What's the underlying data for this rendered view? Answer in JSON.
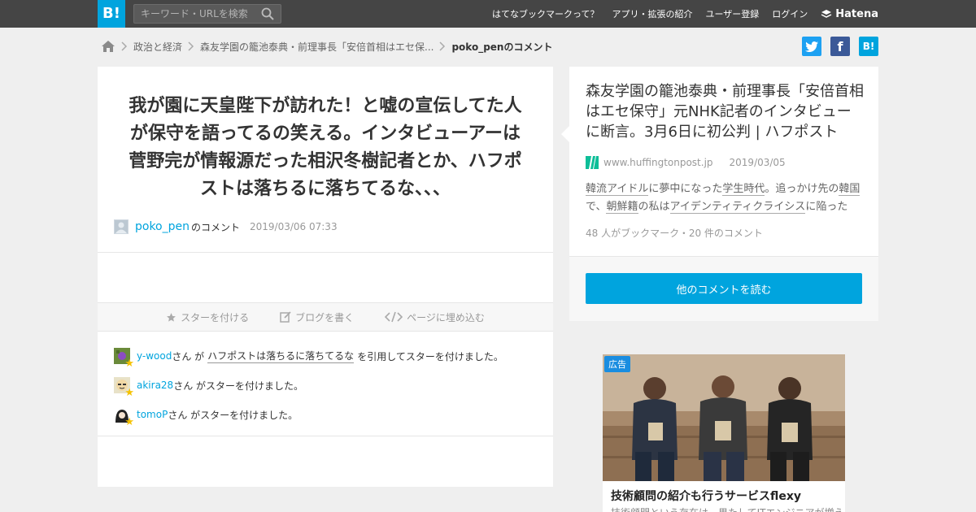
{
  "header": {
    "logo": "B!",
    "search_placeholder": "キーワード・URLを検索",
    "nav": [
      "はてなブックマークって？",
      "アプリ・拡張の紹介",
      "ユーザー登録",
      "ログイン"
    ],
    "brand": "Hatena"
  },
  "breadcrumb": {
    "items": [
      "政治と経済",
      "森友学園の籠池泰典・前理事長「安倍首相はエセ保...",
      "poko_penのコメント"
    ]
  },
  "share": {
    "facebook": "f",
    "hatena": "B!"
  },
  "comment": {
    "text": "我が園に天皇陛下が訪れた！と嘘の宣伝してた人が保守を語ってるの笑える。インタビューアーは菅野完が情報源だった相沢冬樹記者とか、ハフポストは落ちるに落ちてるな、、、",
    "user": "poko_pen",
    "user_suffix": "のコメント",
    "date": "2019/03/06 07:33"
  },
  "actions": {
    "star": "スターを付ける",
    "blog": "ブログを書く",
    "embed": "ページに埋め込む"
  },
  "stars": [
    {
      "user": "y-wood",
      "pre": "さん が",
      "quote": "ハフポストは落ちるに落ちてるな",
      "post": "を引用してスターを付けました。"
    },
    {
      "user": "akira28",
      "pre": "さん がスターを付けました。",
      "quote": "",
      "post": ""
    },
    {
      "user": "tomoP",
      "pre": "さん がスターを付けました。",
      "quote": "",
      "post": ""
    }
  ],
  "entry": {
    "title": "森友学園の籠池泰典・前理事長「安倍首相はエセ保守」元NHK記者のインタビューに断言。3月6日に初公判 | ハフポスト",
    "site": "www.huffingtonpost.jp",
    "date": "2019/03/05",
    "excerpt_parts": [
      {
        "t": "韓流アイドル",
        "kw": true
      },
      {
        "t": "に夢中になった",
        "kw": false
      },
      {
        "t": "学生時代",
        "kw": true
      },
      {
        "t": "。追っかけ先の",
        "kw": false
      },
      {
        "t": "韓国",
        "kw": true
      },
      {
        "t": "で、",
        "kw": false
      },
      {
        "t": "朝鮮籍",
        "kw": true
      },
      {
        "t": "の私は",
        "kw": false
      },
      {
        "t": "アイデンティティクライシス",
        "kw": true
      },
      {
        "t": "に陥った",
        "kw": false
      }
    ],
    "counts": "48 人がブックマーク・20 件のコメント",
    "read_button": "他のコメントを読む"
  },
  "ad": {
    "label": "広告",
    "title": "技術顧問の紹介も行うサービスflexy",
    "subtitle": "技術顧問という存在は、果たしてITエンジニアが増える"
  },
  "colors": {
    "accent": "#00a4de",
    "header_bg": "#454545",
    "twitter": "#1da1f2",
    "facebook": "#3b5998"
  }
}
